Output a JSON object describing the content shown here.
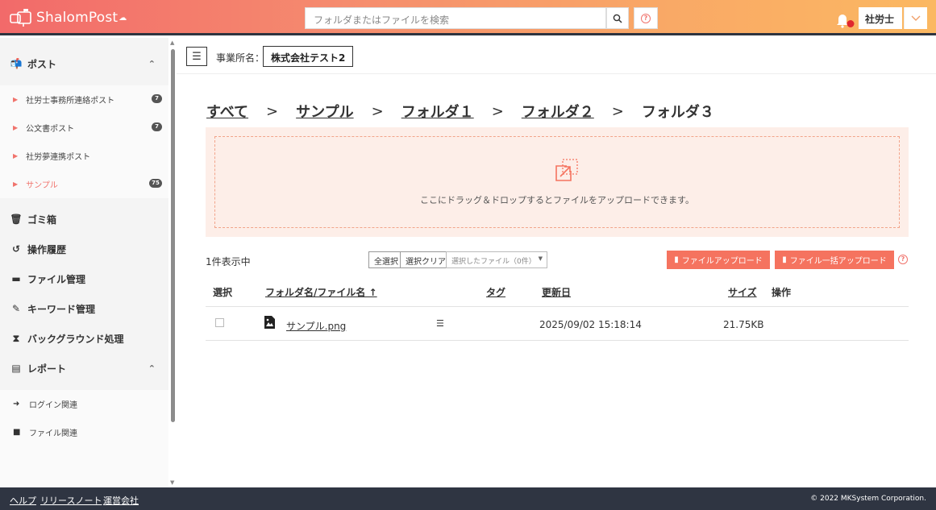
{
  "header": {
    "logo_text": "ShalomPost",
    "search_placeholder": "フォルダまたはファイルを検索",
    "help_mark": "?",
    "user_name": "社労士"
  },
  "sidebar": {
    "post_section": {
      "label": "ポスト",
      "items": [
        {
          "label": "社労士事務所連絡ポスト",
          "badge": "7"
        },
        {
          "label": "公文書ポスト",
          "badge": "7"
        },
        {
          "label": "社労夢連携ポスト",
          "badge": ""
        },
        {
          "label": "サンプル",
          "badge": "75",
          "active": true
        }
      ]
    },
    "menu": [
      {
        "label": "ゴミ箱",
        "icon": "trash-icon"
      },
      {
        "label": "操作履歴",
        "icon": "history-icon"
      },
      {
        "label": "ファイル管理",
        "icon": "drawer-icon"
      },
      {
        "label": "キーワード管理",
        "icon": "tag-icon"
      },
      {
        "label": "バックグラウンド処理",
        "icon": "hourglass-icon"
      }
    ],
    "report_section": {
      "label": "レポート",
      "items": [
        {
          "label": "ログイン関連",
          "icon": "login-icon"
        },
        {
          "label": "ファイル関連",
          "icon": "file-icon"
        }
      ]
    }
  },
  "toolbar": {
    "office_label": "事業所名：",
    "office_value": "株式会社テスト2"
  },
  "breadcrumbs": [
    "すべて",
    "サンプル",
    "フォルダ１",
    "フォルダ２",
    "フォルダ３"
  ],
  "breadcrumb_separator": ">",
  "drop_zone": {
    "text": "ここにドラッグ＆ドロップするとファイルをアップロードできます。"
  },
  "list": {
    "count_text": "1件表示中",
    "select_all": "全選択",
    "select_clear": "選択クリア",
    "selected_dropdown": "選択したファイル（0件）",
    "upload_button": "ファイルアップロード",
    "bulk_upload_button": "ファイル一括アップロード",
    "columns": {
      "select": "選択",
      "name": "フォルダ名/ファイル名 ↑",
      "tag": "タグ",
      "updated": "更新日",
      "size": "サイズ",
      "action": "操作"
    },
    "rows": [
      {
        "name": "サンプル.png",
        "updated": "2025/09/02 15:18:14",
        "size": "21.75KB"
      }
    ]
  },
  "footer": {
    "links": [
      "ヘルプ",
      "リリースノート",
      "運営会社"
    ],
    "copyright": "© 2022 MKSystem Corporation."
  },
  "colors": {
    "accent": "#f5735f",
    "footer": "#2f3542",
    "sidebar": "#f4f4f4"
  }
}
